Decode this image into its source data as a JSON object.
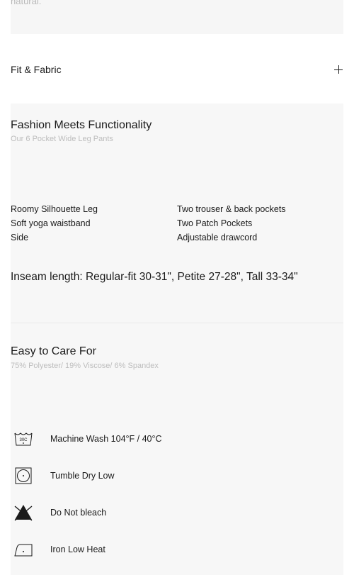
{
  "top_panel": {
    "faded_text": "natural."
  },
  "accordion": {
    "fit_fabric_label": "Fit & Fabric"
  },
  "fashion": {
    "title": "Fashion Meets Functionality",
    "subtitle": "Our 6 Pocket Wide Leg Pants",
    "features_left": [
      "Roomy Silhouette Leg",
      "Soft yoga waistband",
      "Side"
    ],
    "features_right": [
      "Two trouser & back pockets",
      "Two Patch Pockets",
      "Adjustable drawcord"
    ],
    "inseam": "Inseam length: Regular-fit 30-31\", Petite 27-28\", Tall 33-34\""
  },
  "care": {
    "title": "Easy to Care For",
    "subtitle": "75% Polyester/ 19% Viscose/ 6% Spandex",
    "items": [
      {
        "icon": "machine-wash-icon",
        "icon_text": "30C",
        "label": "Machine Wash 104°F / 40°C"
      },
      {
        "icon": "tumble-dry-icon",
        "label": "Tumble Dry Low"
      },
      {
        "icon": "do-not-bleach-icon",
        "label": "Do Not bleach"
      },
      {
        "icon": "iron-low-heat-icon",
        "label": "Iron Low Heat"
      }
    ]
  }
}
